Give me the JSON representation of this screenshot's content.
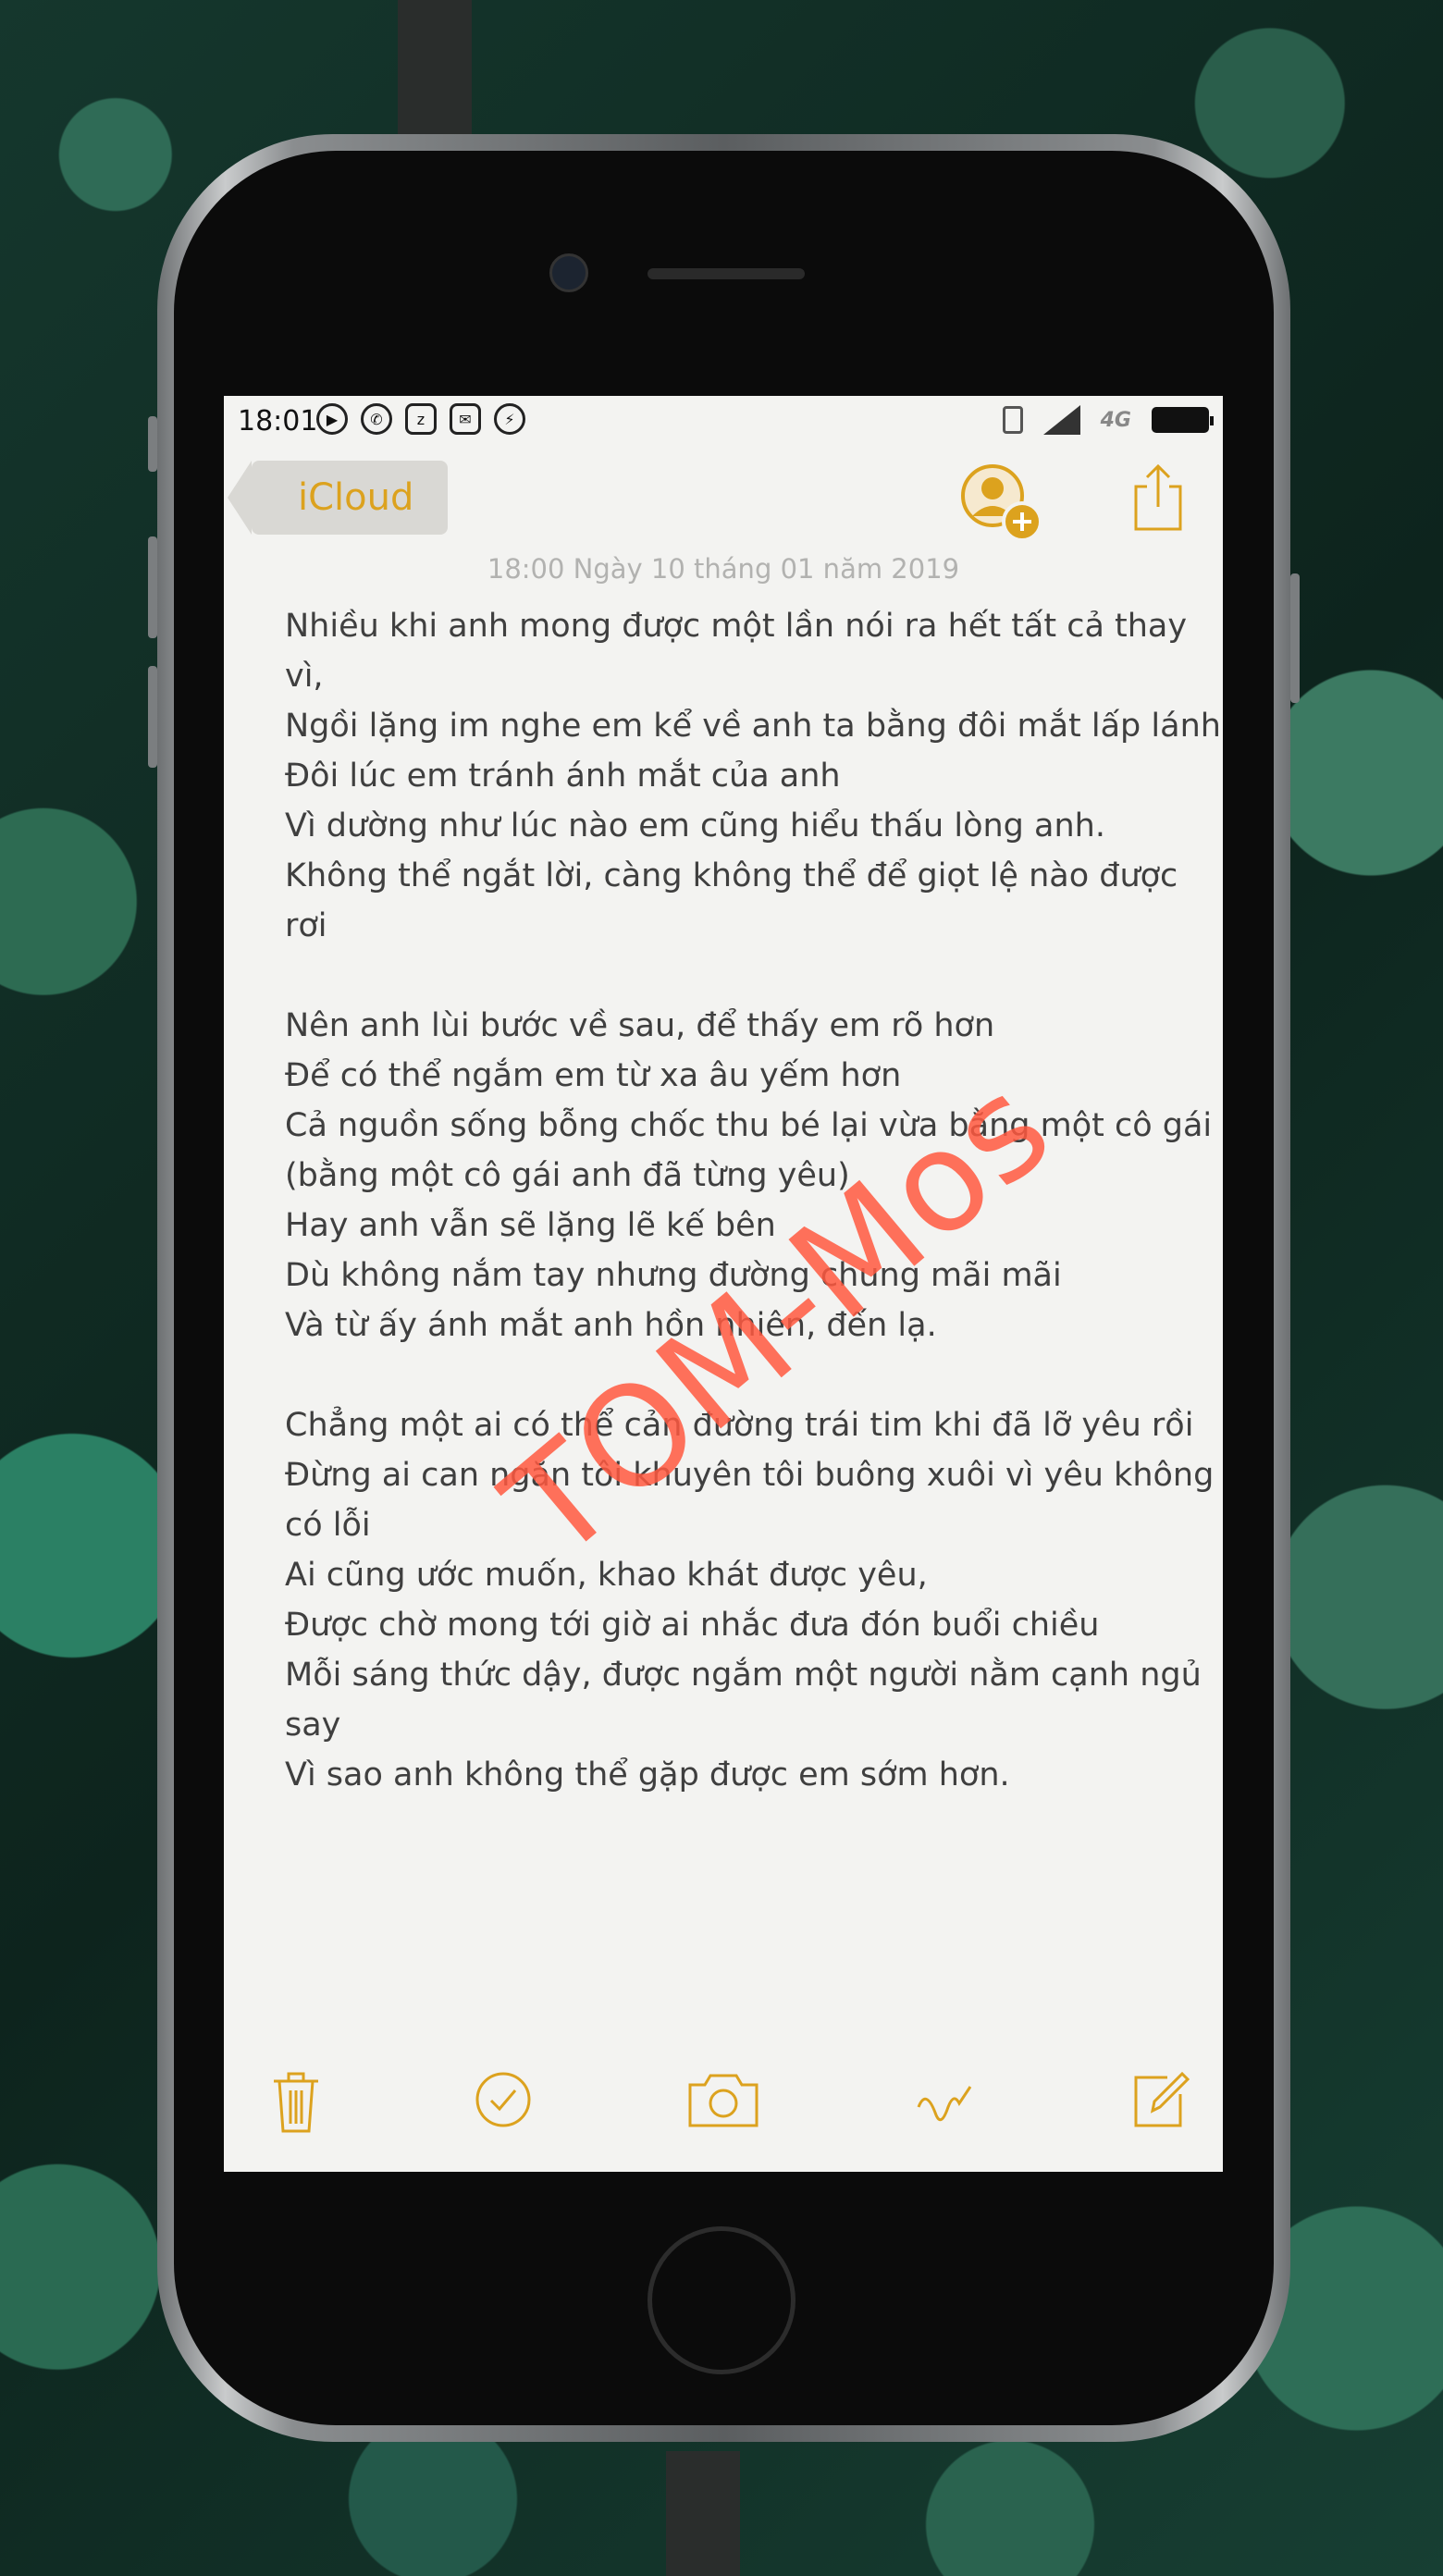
{
  "status_bar": {
    "time": "18:01",
    "notification_icons": [
      "play-circle-icon",
      "phone-icon",
      "zalo-icon",
      "chat-icon",
      "messenger-icon"
    ],
    "network_label": "4G"
  },
  "nav": {
    "back_label": "iCloud"
  },
  "note": {
    "date": "18:00 Ngày 10 tháng 01 năm 2019",
    "lines": [
      "Nhiều khi anh mong được một lần nói ra hết tất cả thay",
      "vì,",
      "Ngồi lặng im nghe em kể về anh ta bằng đôi mắt lấp lánh",
      "Đôi lúc em tránh ánh mắt của anh",
      "Vì dường như lúc nào em cũng hiểu thấu lòng anh.",
      "Không thể ngắt lời, càng không thể để giọt lệ nào được",
      "rơi",
      "",
      "Nên anh lùi bước về sau, để thấy em rõ hơn",
      "Để có thể ngắm em từ xa âu yếm hơn",
      "Cả nguồn sống bỗng chốc thu bé lại vừa bằng một cô gái",
      "(bằng một cô gái anh đã từng yêu)",
      "Hay anh vẫn sẽ lặng lẽ kế bên",
      "Dù không nắm tay nhưng đường chung mãi mãi",
      "Và từ ấy ánh mắt anh hồn nhiên, đến lạ.",
      "",
      "Chẳng một ai có thể cản đường trái tim khi đã lỡ yêu rồi",
      "Đừng ai can ngăn tôi khuyên tôi buông xuôi vì yêu không",
      "có lỗi",
      "Ai cũng ước muốn, khao khát được yêu,",
      "Được chờ mong tới giờ ai nhắc đưa đón buổi chiều",
      "Mỗi sáng thức dậy, được ngắm một người nằm cạnh ngủ",
      "say",
      "Vì sao anh không thể gặp được em sớm hơn."
    ]
  },
  "watermark": "TOM-Mos",
  "toolbar": {
    "items": [
      "trash-icon",
      "checklist-icon",
      "camera-icon",
      "sketch-icon",
      "compose-icon"
    ]
  },
  "colors": {
    "accent": "#dca21e",
    "paper": "#f3f3f1",
    "text": "#3f3f3f",
    "watermark": "#ff5840"
  }
}
